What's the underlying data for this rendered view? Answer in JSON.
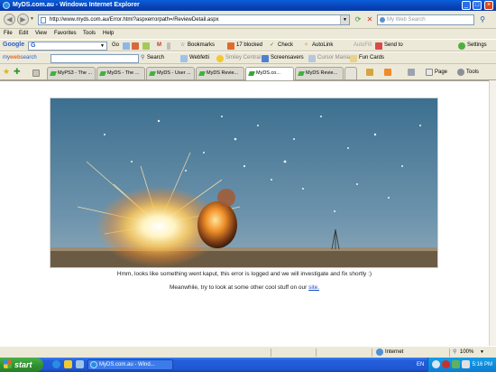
{
  "window": {
    "title": "MyDS.com.au - Windows Internet Explorer"
  },
  "address_bar": {
    "url": "http://www.myds.com.au/Error.html?aspxerrorpath=/ReviewDetail.aspx",
    "search_placeholder": "My Web Search"
  },
  "menu": {
    "items": [
      "File",
      "Edit",
      "View",
      "Favorites",
      "Tools",
      "Help"
    ]
  },
  "google_toolbar": {
    "brand": "Google",
    "go_label": "Go",
    "bookmarks_label": "Bookmarks",
    "blocked_label": "17 blocked",
    "check_label": "Check",
    "autolink_label": "AutoLink",
    "autofill_label": "AutoFill",
    "sendto_label": "Send to",
    "settings_label": "Settings"
  },
  "mywebsearch_toolbar": {
    "brand_prefix": "my",
    "brand_main": "web",
    "brand_suffix": "search",
    "search_label": "Search",
    "webfetti_label": "Webfetti",
    "smiley_label": "Smiley Central",
    "screensavers_label": "Screensavers",
    "cursor_label": "Cursor Mania",
    "funcards_label": "Fun Cards"
  },
  "tabs": [
    {
      "label": "MyPS3 - The ...",
      "active": false
    },
    {
      "label": "MyDS - The ...",
      "active": false
    },
    {
      "label": "MyDS - User ...",
      "active": false
    },
    {
      "label": "MyDS Revie...",
      "active": false
    },
    {
      "label": "MyDS.co...",
      "active": true
    },
    {
      "label": "MyDS Revie...",
      "active": false
    }
  ],
  "command_bar": {
    "page_label": "Page",
    "tools_label": "Tools"
  },
  "page": {
    "error_message": "Hmm, looks like something went kaput, this error is logged and we will investigate and fix shortly :)",
    "meanwhile_text": "Meanwhile, try to look at some other cool stuff on our",
    "site_link": "site."
  },
  "status_bar": {
    "zone": "Internet",
    "zoom": "100%"
  },
  "taskbar": {
    "start_label": "start",
    "window_button": "MyDS.com.au - Wind...",
    "language": "EN",
    "clock": "5:16 PM"
  }
}
